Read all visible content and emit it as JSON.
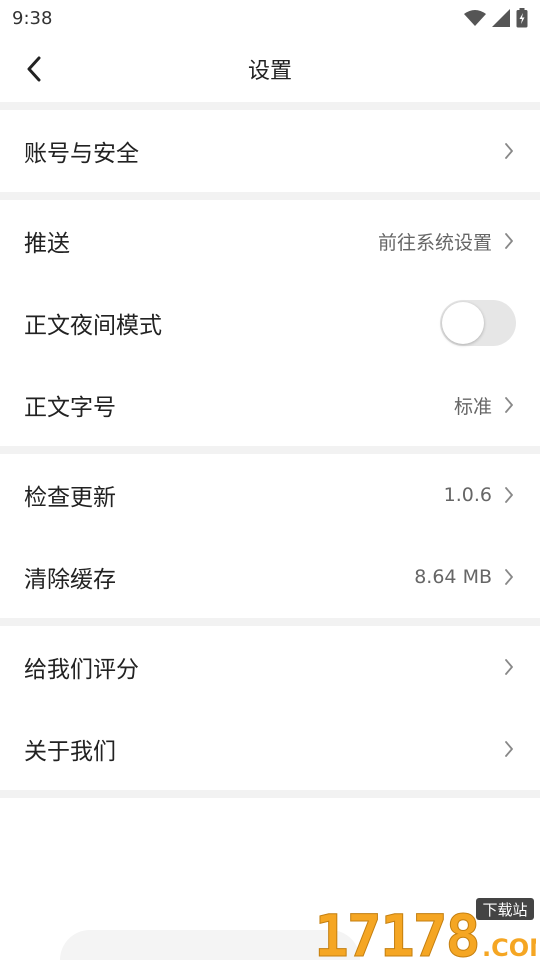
{
  "status_bar": {
    "time": "9:38"
  },
  "nav": {
    "title": "设置"
  },
  "sections": [
    [
      {
        "label": "账号与安全",
        "value": ""
      }
    ],
    [
      {
        "label": "推送",
        "value": "前往系统设置"
      },
      {
        "label": "正文夜间模式",
        "toggle": false
      },
      {
        "label": "正文字号",
        "value": "标准"
      }
    ],
    [
      {
        "label": "检查更新",
        "value": "1.0.6"
      },
      {
        "label": "清除缓存",
        "value": "8.64 MB"
      }
    ],
    [
      {
        "label": "给我们评分",
        "value": ""
      },
      {
        "label": "关于我们",
        "value": ""
      }
    ]
  ],
  "watermark": {
    "text": "17178",
    "sub": ".COM",
    "tag": "下载站"
  },
  "colors": {
    "divider": "#f2f2f2",
    "toggle_off": "#e6e6e6",
    "watermark_orange": "#f5a623"
  }
}
